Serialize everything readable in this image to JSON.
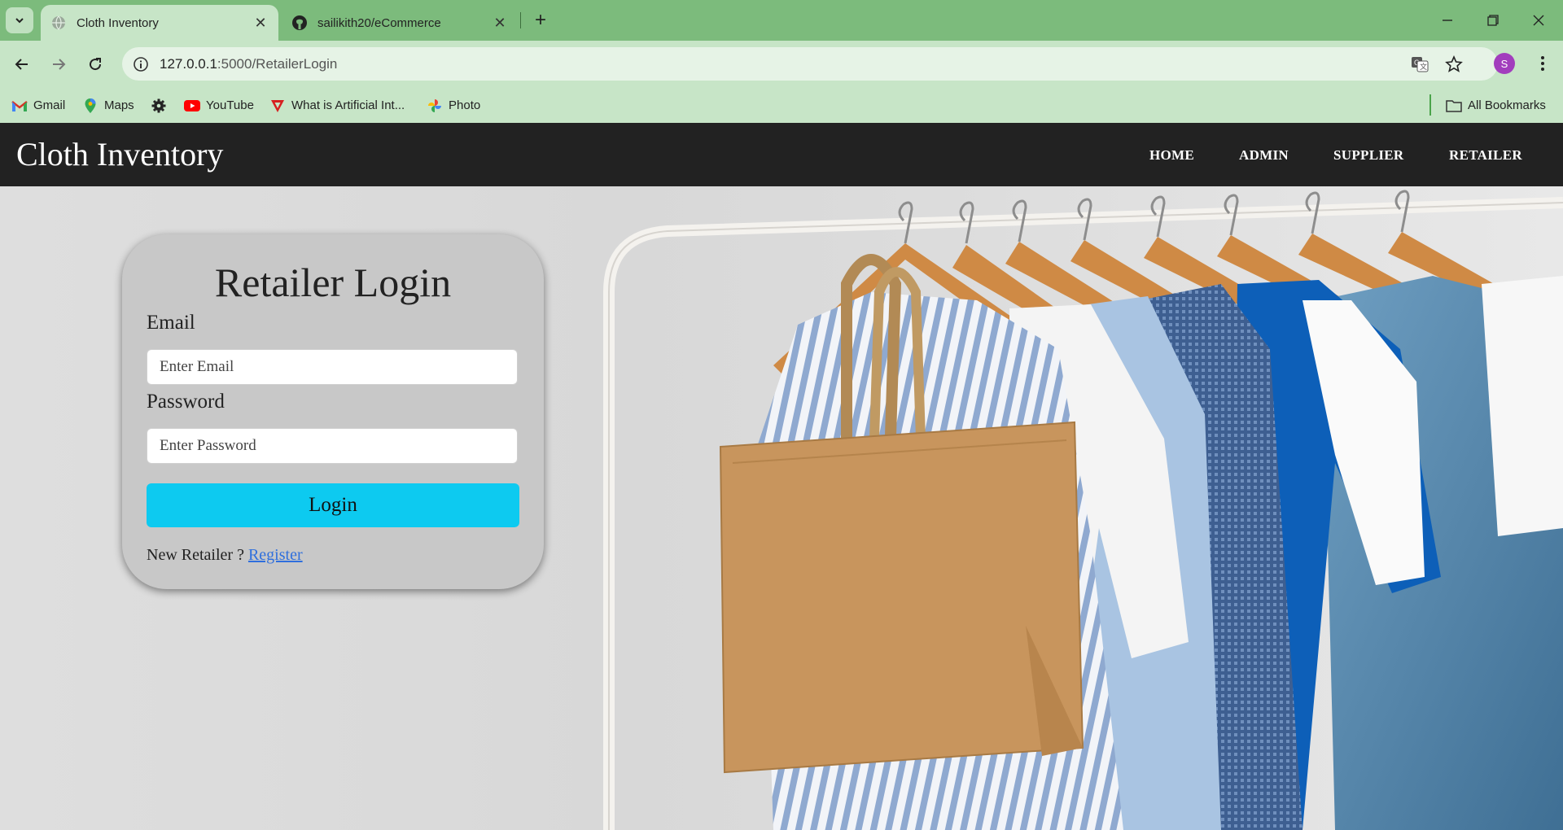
{
  "browser": {
    "tabs": [
      {
        "title": "Cloth Inventory",
        "active": true
      },
      {
        "title": "sailikith20/eCommerce",
        "active": false
      }
    ],
    "url": {
      "host": "127.0.0.1",
      "rest": ":5000/RetailerLogin"
    },
    "bookmarks": [
      "Gmail",
      "Maps",
      "YouTube",
      "What is Artificial Int...",
      "Photo"
    ],
    "all_bookmarks_label": "All Bookmarks",
    "profile_initial": "S",
    "colors": {
      "frame": "#7cbb7c",
      "toolbar": "#c7e5c7",
      "avatar": "#a23dbd"
    }
  },
  "site": {
    "brand": "Cloth Inventory",
    "nav": [
      "HOME",
      "ADMIN",
      "SUPPLIER",
      "RETAILER"
    ],
    "colors": {
      "navbar": "#222222",
      "button": "#0dcaf0",
      "link": "#2f6fdd"
    }
  },
  "login": {
    "title": "Retailer Login",
    "email_label": "Email",
    "email_placeholder": "Enter Email",
    "password_label": "Password",
    "password_placeholder": "Enter Password",
    "button_label": "Login",
    "register_prompt": "New Retailer ?",
    "register_link": "Register"
  }
}
